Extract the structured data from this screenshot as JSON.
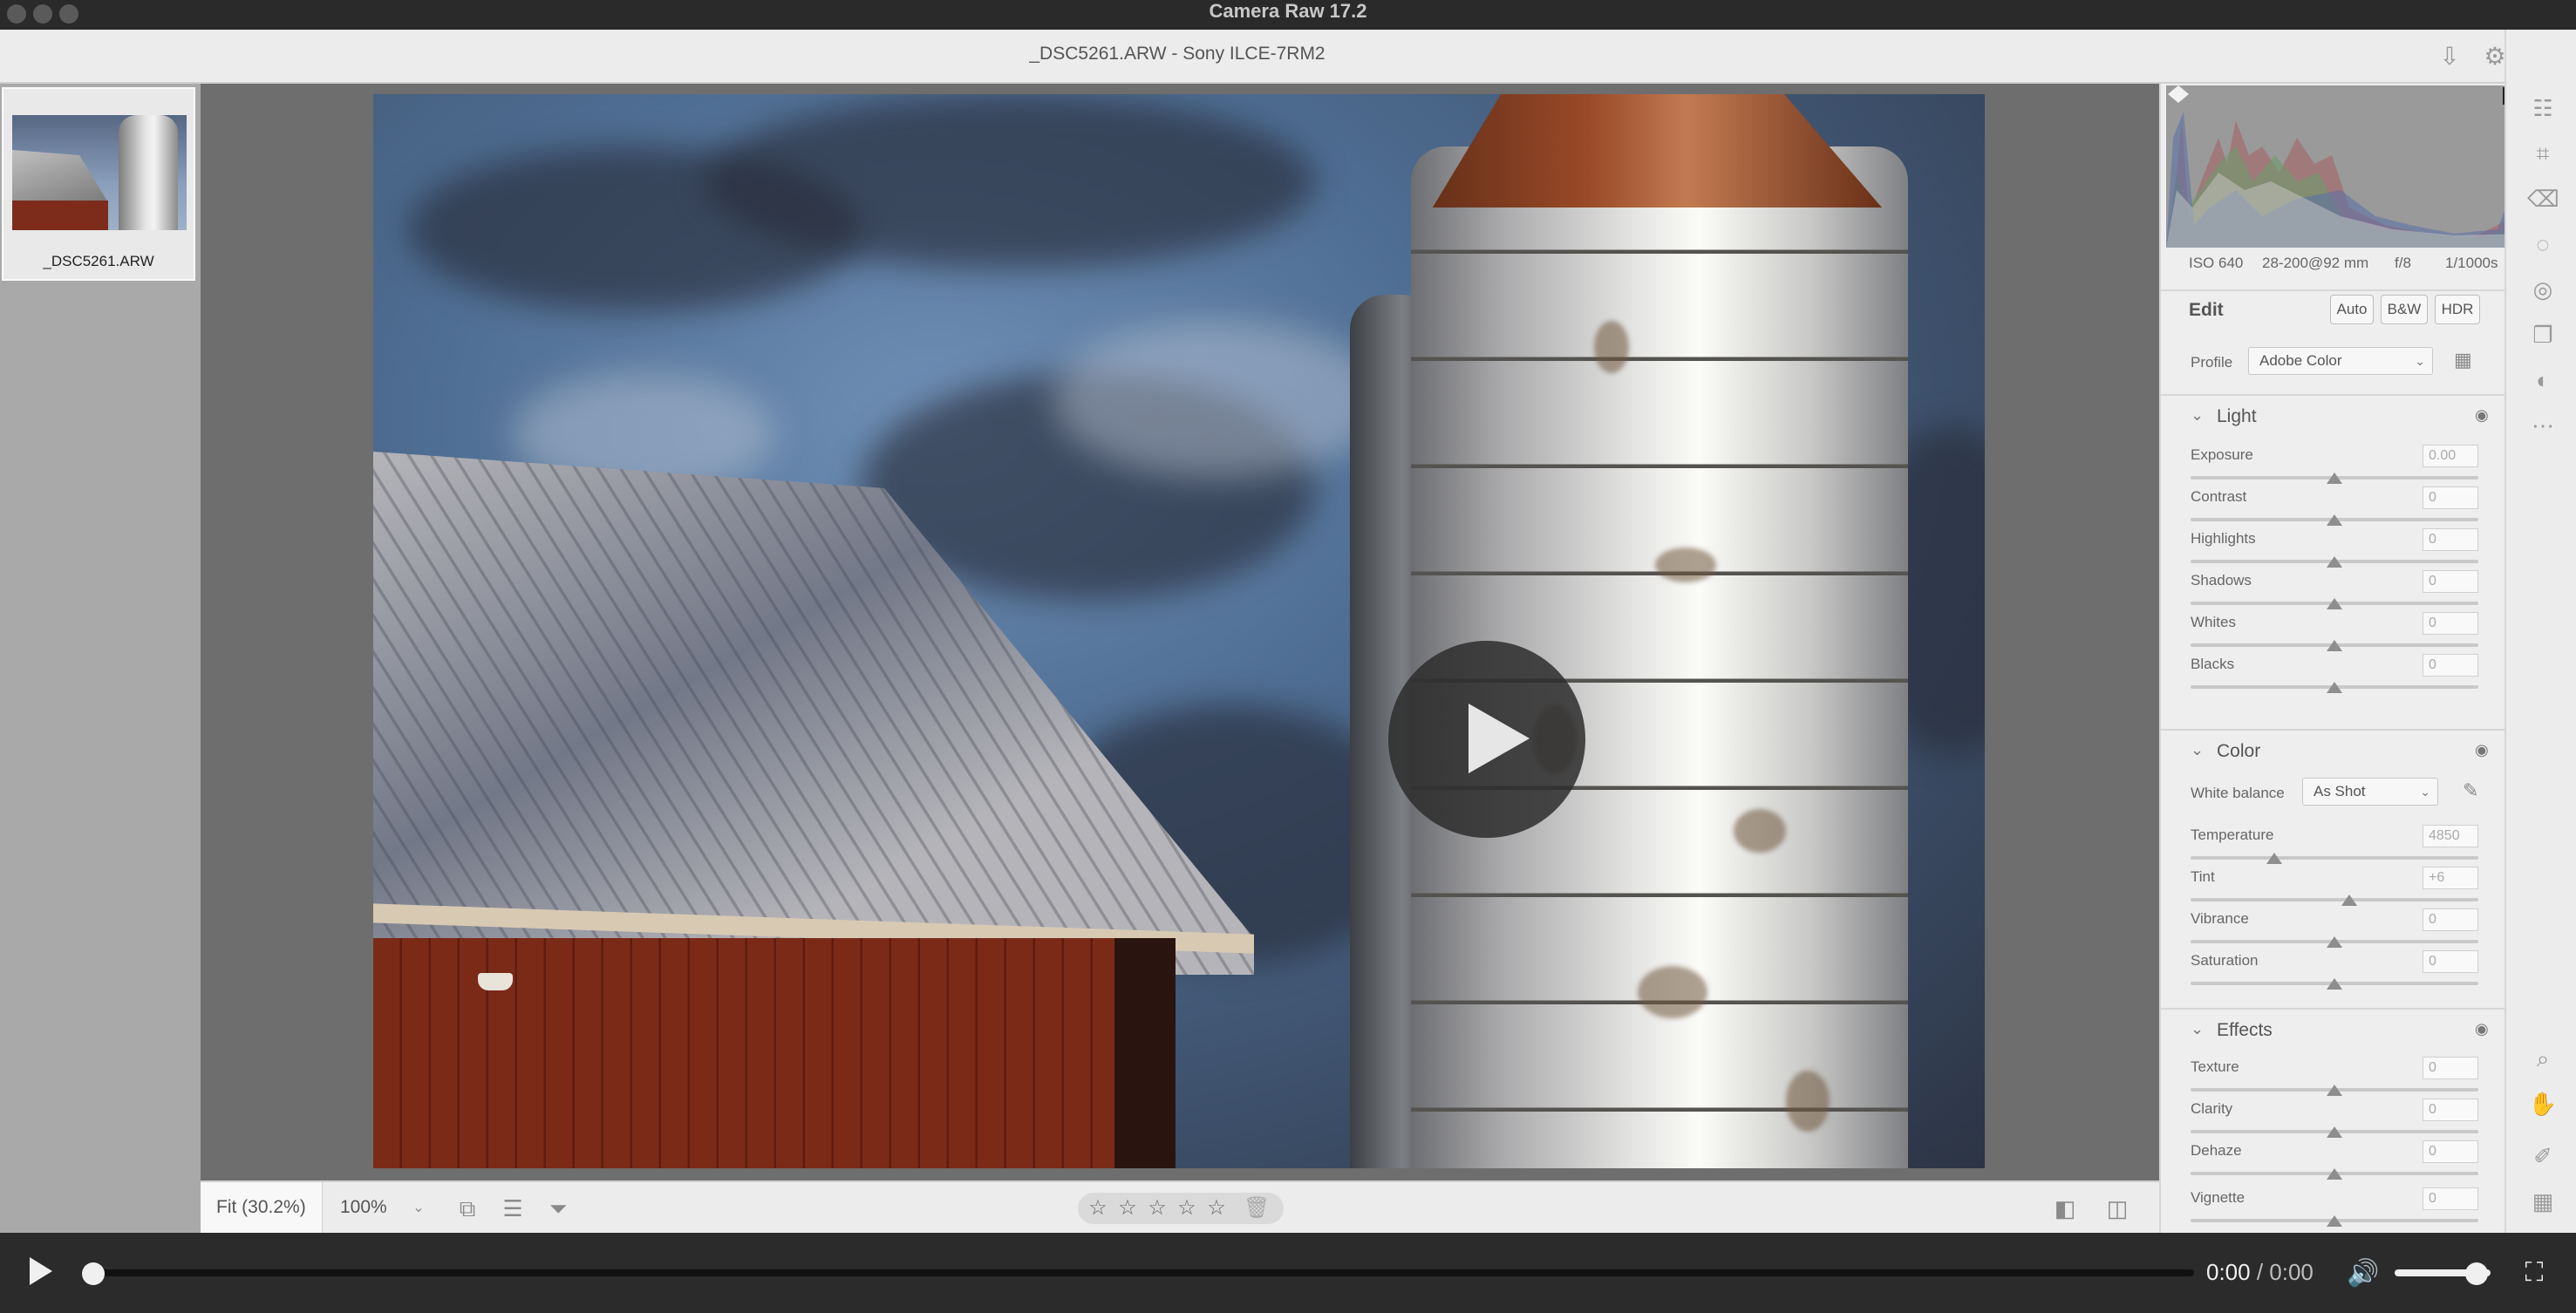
{
  "window": {
    "title": "Camera Raw 17.2"
  },
  "header": {
    "file_info": "_DSC5261.ARW  -  Sony ILCE-7RM2"
  },
  "filmstrip": {
    "items": [
      {
        "caption": "_DSC5261.ARW"
      }
    ]
  },
  "toolbar": {
    "fit_label": "Fit (30.2%)",
    "zoom_value": "100%",
    "stars": [
      "☆",
      "☆",
      "☆",
      "☆",
      "☆"
    ]
  },
  "exif": {
    "iso": "ISO 640",
    "lens": "28-200@92 mm",
    "aperture": "f/8",
    "shutter": "1/1000s"
  },
  "edit": {
    "title": "Edit",
    "buttons": [
      "Auto",
      "B&W",
      "HDR"
    ],
    "profile_label": "Profile",
    "profile_value": "Adobe Color"
  },
  "light": {
    "title": "Light",
    "sliders": [
      {
        "label": "Exposure",
        "value": "0.00",
        "level": 0.5
      },
      {
        "label": "Contrast",
        "value": "0",
        "level": 0.5
      },
      {
        "label": "Highlights",
        "value": "0",
        "level": 0.5
      },
      {
        "label": "Shadows",
        "value": "0",
        "level": 0.5
      },
      {
        "label": "Whites",
        "value": "0",
        "level": 0.5
      },
      {
        "label": "Blacks",
        "value": "0",
        "level": 0.5
      }
    ]
  },
  "color": {
    "title": "Color",
    "wb_label": "White balance",
    "wb_value": "As Shot",
    "sliders": [
      {
        "label": "Temperature",
        "value": "4850",
        "level": 0.29
      },
      {
        "label": "Tint",
        "value": "+6",
        "level": 0.55
      },
      {
        "label": "Vibrance",
        "value": "0",
        "level": 0.5
      },
      {
        "label": "Saturation",
        "value": "0",
        "level": 0.5
      }
    ]
  },
  "effects": {
    "title": "Effects",
    "sliders": [
      {
        "label": "Texture",
        "value": "0",
        "level": 0.5
      },
      {
        "label": "Clarity",
        "value": "0",
        "level": 0.5
      },
      {
        "label": "Dehaze",
        "value": "0",
        "level": 0.5
      },
      {
        "label": "Vignette",
        "value": "0",
        "level": 0.5
      }
    ]
  },
  "video": {
    "current": "0:00",
    "separator": " / ",
    "duration": "0:00",
    "progress": 0,
    "volume": 0.85
  },
  "icons": {
    "header": [
      "save-icon",
      "gear-icon",
      "expand-icon"
    ],
    "rail": [
      "sliders-icon",
      "crop-icon",
      "eraser-icon",
      "mask-icon",
      "red-eye-icon",
      "snapshots-icon",
      "presets-icon",
      "more-icon",
      "zoom-icon",
      "hand-icon",
      "sampler-icon",
      "grid-icon"
    ]
  },
  "colors": {
    "accent": "#2b2b2b",
    "panel": "#eeeeee",
    "canvas": "#6e6e6e"
  }
}
